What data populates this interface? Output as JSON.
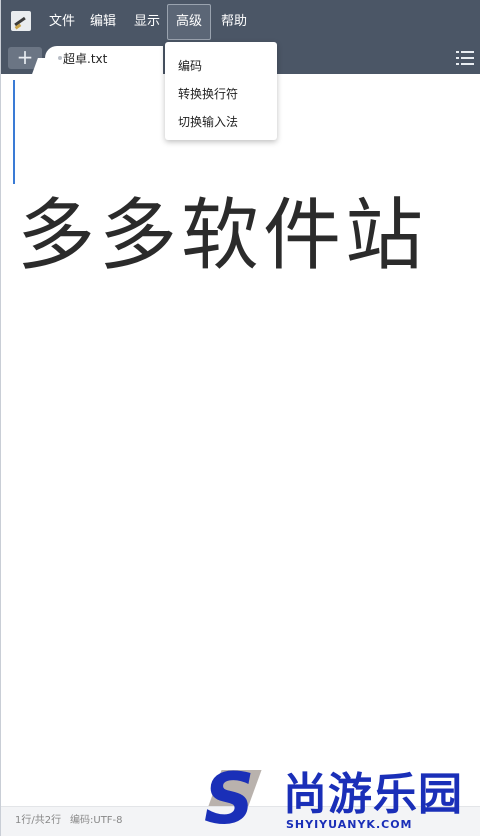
{
  "menubar": {
    "items": [
      "文件",
      "编辑",
      "显示",
      "高级",
      "帮助"
    ],
    "active_index": 3
  },
  "tabs": {
    "new_tab_symbol": "+",
    "active_tab_title": "超卓.txt"
  },
  "editor": {
    "content": "多多软件站"
  },
  "dropdown": {
    "items": [
      "编码",
      "转换换行符",
      "切换输入法"
    ]
  },
  "statusbar": {
    "position": "1行/共2行",
    "encoding": "编码:UTF-8"
  },
  "watermark": {
    "logo_letter": "S",
    "cn_text": "尚游乐园",
    "en_text": "SHYIYUANYK.COM"
  },
  "colors": {
    "toolbar": "#4b5666",
    "watermark": "#1a2fb8",
    "caret": "#3a7bd5"
  },
  "icons": {
    "logo": "app-logo-icon",
    "list": "list-icon"
  }
}
